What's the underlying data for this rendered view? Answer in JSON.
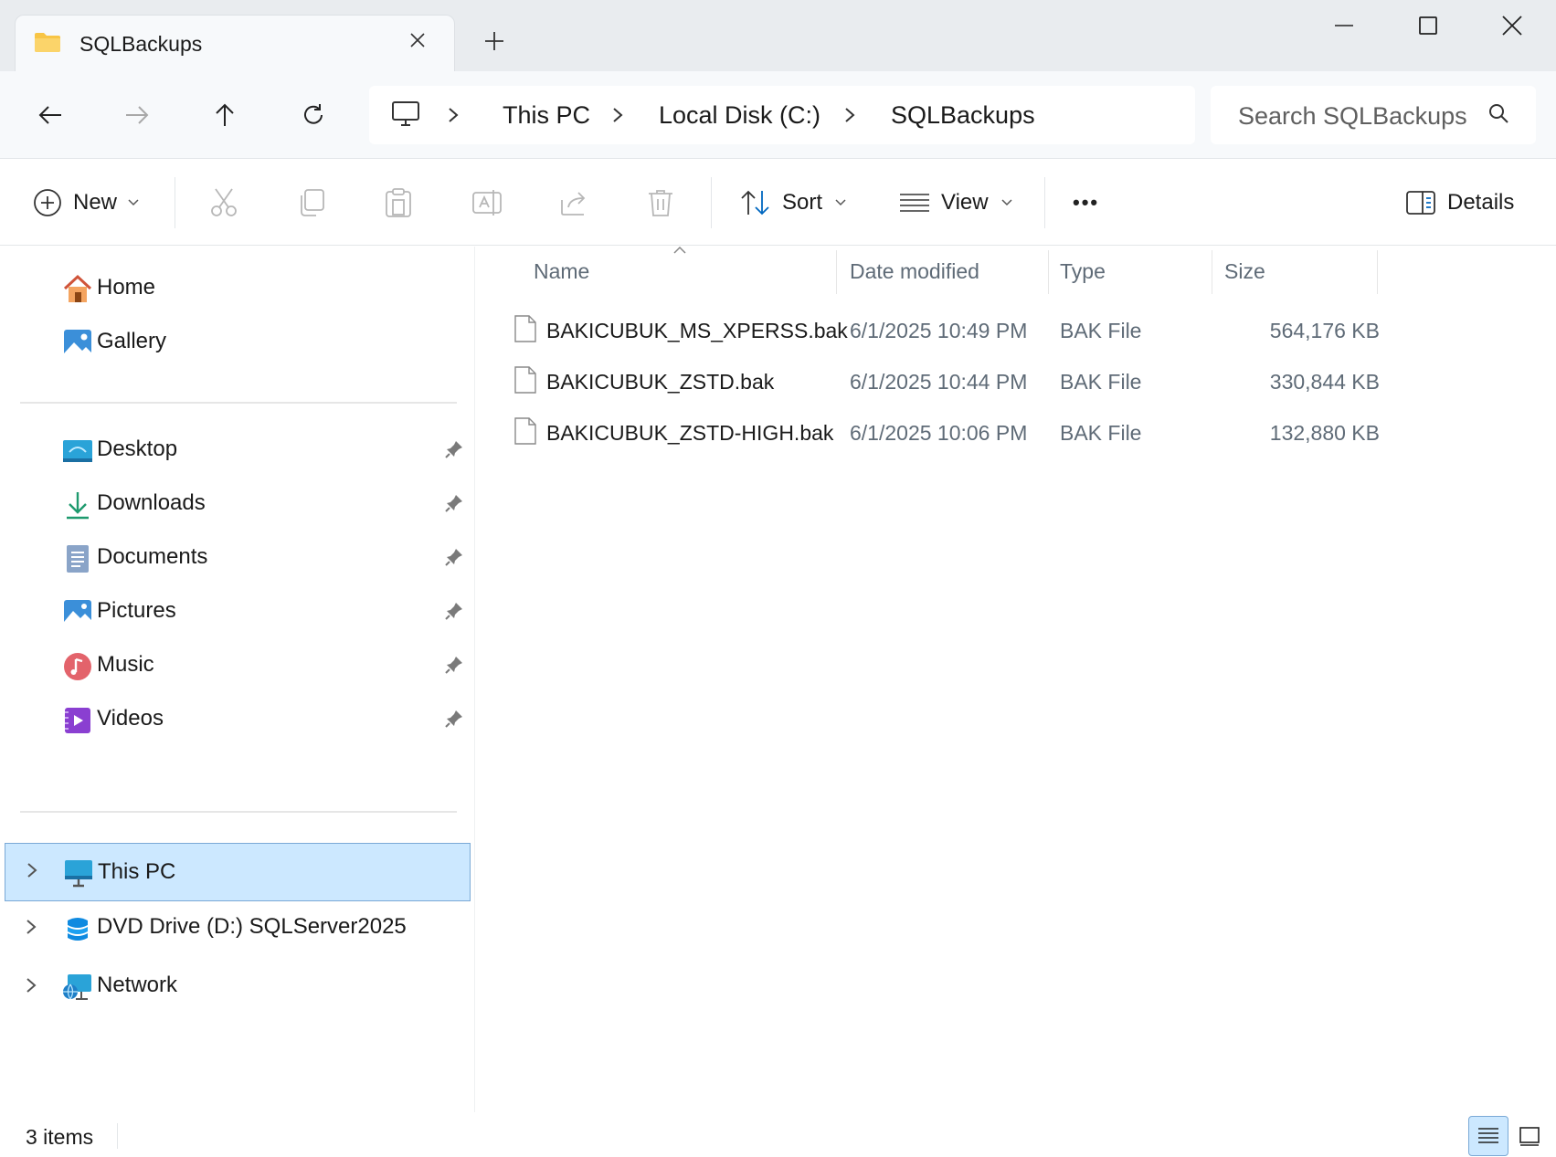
{
  "window": {
    "tab_title": "SQLBackups",
    "new_tab_label": "+"
  },
  "address": {
    "breadcrumbs": [
      "This PC",
      "Local Disk (C:)",
      "SQLBackups"
    ],
    "search_placeholder": "Search SQLBackups"
  },
  "toolbar": {
    "new_label": "New",
    "sort_label": "Sort",
    "view_label": "View",
    "more_label": "•••",
    "details_label": "Details"
  },
  "sidebar": {
    "top_items": [
      {
        "label": "Home",
        "icon": "home-icon"
      },
      {
        "label": "Gallery",
        "icon": "gallery-icon"
      }
    ],
    "quick_access": [
      {
        "label": "Desktop",
        "icon": "desktop-icon"
      },
      {
        "label": "Downloads",
        "icon": "downloads-icon"
      },
      {
        "label": "Documents",
        "icon": "documents-icon"
      },
      {
        "label": "Pictures",
        "icon": "pictures-icon"
      },
      {
        "label": "Music",
        "icon": "music-icon"
      },
      {
        "label": "Videos",
        "icon": "videos-icon"
      }
    ],
    "drives": [
      {
        "label": "This PC",
        "icon": "this-pc-icon",
        "selected": true
      },
      {
        "label": "DVD Drive (D:) SQLServer2025",
        "icon": "dvd-drive-icon"
      },
      {
        "label": "Network",
        "icon": "network-icon"
      }
    ]
  },
  "file_list": {
    "columns": [
      "Name",
      "Date modified",
      "Type",
      "Size"
    ],
    "rows": [
      {
        "name": "BAKICUBUK_MS_XPERSS.bak",
        "date": "6/1/2025 10:49 PM",
        "type": "BAK File",
        "size": "564,176 KB"
      },
      {
        "name": "BAKICUBUK_ZSTD.bak",
        "date": "6/1/2025 10:44 PM",
        "type": "BAK File",
        "size": "330,844 KB"
      },
      {
        "name": "BAKICUBUK_ZSTD-HIGH.bak",
        "date": "6/1/2025 10:06 PM",
        "type": "BAK File",
        "size": "132,880 KB"
      }
    ]
  },
  "status": {
    "item_count": "3 items"
  },
  "colors": {
    "accent": "#0067c0",
    "selection": "#cce8ff",
    "folder": "#f8c545"
  }
}
